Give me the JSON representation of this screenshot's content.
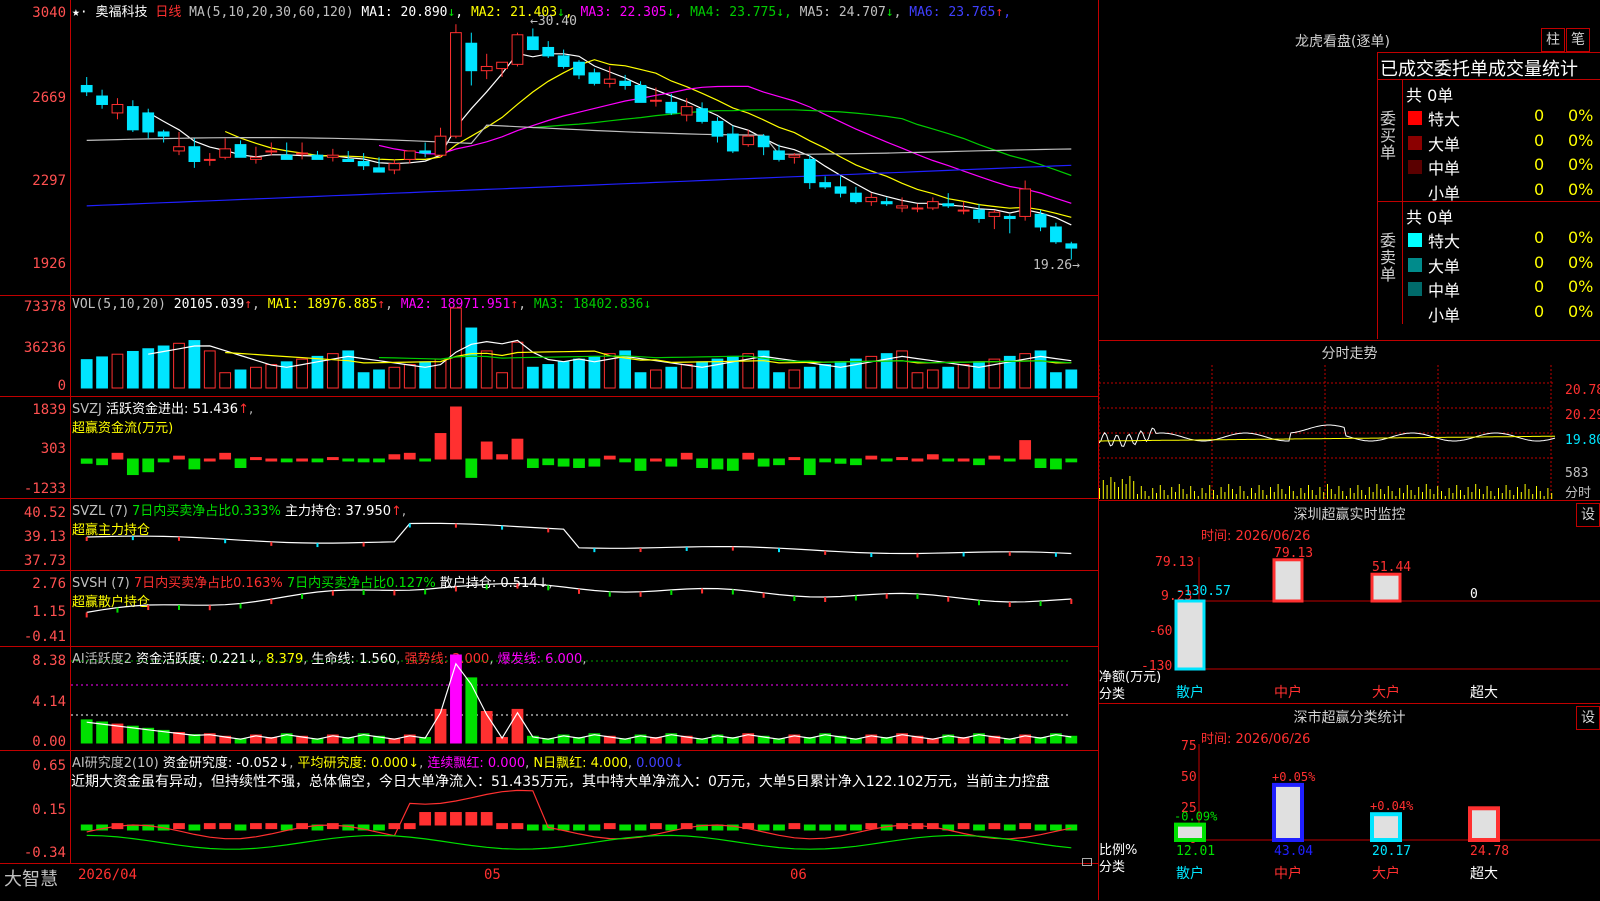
{
  "colors": {
    "up": "#ff3030",
    "down": "#00e5ff",
    "grid": "#c00000",
    "ma1": "#ffffff",
    "ma2": "#ffff00",
    "ma3": "#ff00ff",
    "ma4": "#00cc00",
    "ma5": "#c0c0c0",
    "ma6": "#2020ff"
  },
  "main": {
    "star": "★·",
    "name": "奥福科技",
    "period": "日线",
    "ma_label": "MA(5,10,20,30,60,120)",
    "ma": [
      {
        "key": "MA1",
        "value": "20.890",
        "arrow": "↓",
        "color": "#ffffff"
      },
      {
        "key": "MA2",
        "value": "21.403",
        "arrow": "↓",
        "color": "#ffff00"
      },
      {
        "key": "MA3",
        "value": "22.305",
        "arrow": "↓",
        "color": "#ff00ff"
      },
      {
        "key": "MA4",
        "value": "23.775",
        "arrow": "↓",
        "color": "#00cc00"
      },
      {
        "key": "MA5",
        "value": "24.707",
        "arrow": "↓",
        "color": "#c0c0c0"
      },
      {
        "key": "MA6",
        "value": "23.765",
        "arrow": "↑",
        "color": "#4040ff"
      }
    ],
    "ticks": [
      "3040",
      "2669",
      "2297",
      "1926"
    ],
    "high_label": "←30.40",
    "low_label": "19.26→"
  },
  "vol": {
    "label": "VOL(5,10,20)",
    "value": "20105.039",
    "arrow": "↑",
    "ma": [
      {
        "key": "MA1",
        "value": "18976.885",
        "arrow": "↑"
      },
      {
        "key": "MA2",
        "value": "18971.951",
        "arrow": "↑"
      },
      {
        "key": "MA3",
        "value": "18402.836",
        "arrow": "↓"
      }
    ],
    "ticks": [
      "73378",
      "36236",
      "0"
    ]
  },
  "svzj": {
    "label": "SVZJ",
    "text1": "活跃资金进出:",
    "value": "51.436",
    "arrow": "↑",
    "sub": "超赢资金流(万元)",
    "ticks": [
      "1839",
      "303",
      "-1233"
    ]
  },
  "svzl": {
    "label": "SVZL (7)",
    "text1": "7日内买卖净占比0.333%",
    "text2": "主力持仓:",
    "value": "37.950",
    "arrow": "↑",
    "sub": "超赢主力持仓",
    "ticks": [
      "40.52",
      "39.13",
      "37.73"
    ]
  },
  "svsh": {
    "label": "SVSH (7)",
    "text1": "7日内买卖净占比0.163%",
    "text2": "7日内买卖净占比0.127%",
    "text3": "散户持仓:",
    "value": "0.514",
    "arrow": "↓",
    "sub": "超赢散户持仓",
    "ticks": [
      "2.76",
      "1.15",
      "-0.41"
    ]
  },
  "ai1": {
    "label": "AI活跃度2",
    "t1": "资金活跃度:",
    "v1": "0.221",
    "a1": "↓",
    "v2": "8.379",
    "t3": "生命线:",
    "v3": "1.560",
    "t4": "强势线:",
    "v4": "3.000",
    "t5": "爆发线:",
    "v5": "6.000",
    "ticks": [
      "8.38",
      "4.14",
      "0.00"
    ]
  },
  "ai2": {
    "label": "AI研究度2(10)",
    "t1": "资金研究度:",
    "v1": "-0.052",
    "a1": "↓",
    "t2": "平均研究度:",
    "v2": "0.000",
    "a2": "↓",
    "t3": "连续飘红:",
    "v3": "0.000",
    "t4": "N日飘红:",
    "v4": "4.000",
    "v5": "0.000",
    "a5": "↓",
    "comment": "近期大资金虽有异动，但持续性不强，总体偏空，今日大单净流入：51.435万元，其中特大单净流入：0万元，大单5日累计净入122.102万元，当前主力控盘",
    "ticks": [
      "0.65",
      "0.15",
      "-0.34"
    ]
  },
  "bottom": {
    "brand": "大智慧",
    "dates": [
      "2026/04",
      "05",
      "06"
    ]
  },
  "right": {
    "lhb_title": "龙虎看盘(逐单)",
    "btn1": "柱",
    "btn2": "笔",
    "stat_title": "已成交委托单成交量统计",
    "buy": {
      "side": "委买单",
      "total": "共 0单",
      "rows": [
        {
          "label": "特大",
          "qty": "0",
          "pct": "0%",
          "color": "#ff0000"
        },
        {
          "label": "大单",
          "qty": "0",
          "pct": "0%",
          "color": "#8b0000"
        },
        {
          "label": "中单",
          "qty": "0",
          "pct": "0%",
          "color": "#5a0000"
        },
        {
          "label": "小单",
          "qty": "0",
          "pct": "0%",
          "color": "#000000"
        }
      ]
    },
    "sell": {
      "side": "委卖单",
      "total": "共 0单",
      "rows": [
        {
          "label": "特大",
          "qty": "0",
          "pct": "0%",
          "color": "#00ffff"
        },
        {
          "label": "大单",
          "qty": "0",
          "pct": "0%",
          "color": "#008b8b"
        },
        {
          "label": "中单",
          "qty": "0",
          "pct": "0%",
          "color": "#006a6a"
        },
        {
          "label": "小单",
          "qty": "0",
          "pct": "0%",
          "color": "#000000"
        }
      ]
    },
    "fs_title": "分时走势",
    "fs_ticks": [
      "20.78",
      "20.29",
      "19.80"
    ],
    "fs_vol": "583",
    "fs_sub": "分时",
    "sz_title": "深圳超赢实时监控",
    "sz_btn": "设",
    "sz_time": "时间: 2026/06/26",
    "sz_ticks": [
      "79.13",
      "9.23",
      "-60.67",
      "-130.57"
    ],
    "sz_ylabel": "净额(万元)",
    "sz_xlabel": "分类",
    "sz_cats": [
      "散户",
      "中户",
      "大户",
      "超大"
    ],
    "sz_values": [
      "-130.57",
      "79.13",
      "51.44",
      "0"
    ],
    "ss_title": "深市超赢分类统计",
    "ss_btn": "设",
    "ss_time": "时间: 2026/06/26",
    "ss_ticks": [
      "75",
      "50",
      "25",
      "0"
    ],
    "ss_ylabel": "比例%",
    "ss_xlabel": "分类",
    "ss_cats": [
      "散户",
      "中户",
      "大户",
      "超大"
    ],
    "ss_bottom": [
      "12.01",
      "43.04",
      "20.17",
      "24.78"
    ],
    "ss_delta": [
      "-0.09%",
      "+0.05%",
      "+0.04%",
      ""
    ]
  },
  "chart_data": [
    {
      "type": "candlestick",
      "title": "奥福科技 日线",
      "ylim": [
        19.26,
        30.4
      ],
      "ohlc": [
        [
          27.5,
          27.9,
          27.0,
          27.2
        ],
        [
          27.0,
          27.3,
          26.4,
          26.6
        ],
        [
          26.2,
          26.9,
          25.9,
          26.6
        ],
        [
          26.5,
          26.8,
          25.3,
          25.4
        ],
        [
          26.2,
          26.4,
          25.0,
          25.3
        ],
        [
          25.3,
          25.4,
          24.8,
          25.1
        ],
        [
          24.4,
          25.3,
          24.2,
          24.6
        ],
        [
          24.6,
          25.0,
          23.6,
          23.9
        ],
        [
          24.0,
          24.3,
          23.7,
          24.0
        ],
        [
          24.1,
          25.0,
          24.0,
          24.5
        ],
        [
          24.7,
          24.9,
          24.1,
          24.1
        ],
        [
          24.0,
          24.6,
          23.8,
          24.1
        ],
        [
          24.4,
          24.8,
          24.2,
          24.4
        ],
        [
          24.2,
          24.8,
          24.0,
          24.0
        ],
        [
          24.3,
          24.8,
          24.0,
          24.3
        ],
        [
          24.2,
          24.4,
          24.0,
          24.0
        ],
        [
          24.1,
          24.5,
          23.9,
          24.2
        ],
        [
          24.0,
          24.4,
          23.9,
          23.9
        ],
        [
          23.9,
          24.3,
          23.5,
          23.7
        ],
        [
          23.6,
          24.1,
          23.4,
          23.4
        ],
        [
          23.5,
          24.0,
          23.3,
          23.8
        ],
        [
          24.0,
          24.4,
          23.8,
          24.4
        ],
        [
          24.4,
          24.8,
          24.1,
          24.3
        ],
        [
          24.2,
          25.5,
          24.1,
          25.1
        ],
        [
          25.1,
          30.4,
          25.0,
          30.0
        ],
        [
          29.5,
          30.0,
          27.5,
          28.2
        ],
        [
          28.2,
          29.0,
          27.8,
          28.4
        ],
        [
          28.3,
          28.6,
          27.9,
          28.6
        ],
        [
          28.5,
          30.0,
          28.4,
          29.9
        ],
        [
          29.8,
          30.2,
          29.2,
          29.2
        ],
        [
          29.3,
          29.6,
          28.8,
          28.9
        ],
        [
          28.9,
          29.2,
          28.3,
          28.4
        ],
        [
          28.6,
          28.7,
          27.8,
          28.0
        ],
        [
          28.1,
          28.3,
          27.5,
          27.6
        ],
        [
          27.6,
          28.4,
          27.4,
          27.8
        ],
        [
          27.7,
          28.0,
          27.3,
          27.5
        ],
        [
          27.5,
          27.7,
          26.7,
          26.7
        ],
        [
          26.8,
          27.4,
          26.5,
          26.8
        ],
        [
          26.7,
          27.1,
          26.1,
          26.2
        ],
        [
          26.1,
          26.9,
          25.8,
          26.5
        ],
        [
          26.4,
          26.7,
          25.7,
          25.8
        ],
        [
          25.8,
          26.0,
          24.8,
          25.1
        ],
        [
          25.2,
          25.6,
          24.3,
          24.4
        ],
        [
          24.7,
          25.4,
          24.6,
          25.1
        ],
        [
          25.1,
          25.2,
          24.2,
          24.6
        ],
        [
          24.4,
          24.7,
          23.9,
          24.0
        ],
        [
          24.1,
          24.3,
          23.8,
          24.2
        ],
        [
          24.0,
          24.2,
          22.6,
          22.9
        ],
        [
          22.9,
          23.2,
          22.6,
          22.7
        ],
        [
          22.7,
          23.2,
          22.2,
          22.4
        ],
        [
          22.4,
          22.7,
          21.9,
          22.0
        ],
        [
          22.0,
          22.4,
          21.8,
          22.2
        ],
        [
          22.0,
          22.2,
          21.8,
          21.9
        ],
        [
          21.7,
          22.2,
          21.5,
          21.8
        ],
        [
          21.7,
          21.9,
          21.5,
          21.7
        ],
        [
          21.7,
          22.2,
          21.6,
          22.0
        ],
        [
          21.9,
          22.4,
          21.7,
          21.8
        ],
        [
          21.6,
          22.0,
          21.4,
          21.6
        ],
        [
          21.6,
          21.9,
          21.0,
          21.2
        ],
        [
          21.3,
          21.6,
          20.7,
          21.5
        ],
        [
          21.3,
          21.4,
          20.5,
          21.2
        ],
        [
          21.3,
          23.0,
          21.1,
          22.6
        ],
        [
          21.4,
          21.6,
          20.6,
          20.8
        ],
        [
          20.8,
          21.0,
          20.0,
          20.1
        ],
        [
          20.0,
          20.1,
          19.26,
          19.8
        ]
      ]
    },
    {
      "type": "bar",
      "title": "深圳超赢实时监控",
      "categories": [
        "散户",
        "中户",
        "大户",
        "超大"
      ],
      "values": [
        -130.57,
        79.13,
        51.44,
        0
      ],
      "ylabel": "净额(万元)",
      "xlabel": "分类"
    },
    {
      "type": "bar",
      "title": "深市超赢分类统计",
      "categories": [
        "散户",
        "中户",
        "大户",
        "超大"
      ],
      "values": [
        12.01,
        43.04,
        20.17,
        24.78
      ],
      "ylabel": "比例%",
      "xlabel": "分类",
      "ylim": [
        0,
        75
      ]
    }
  ]
}
